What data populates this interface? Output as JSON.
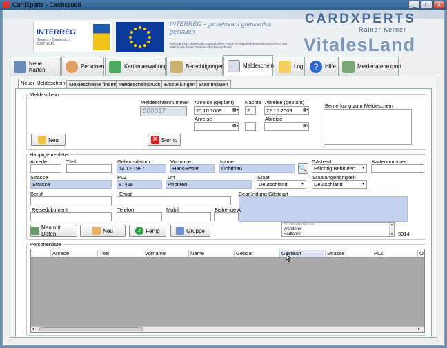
{
  "window": {
    "title": "CardXperts - CardIssueII",
    "min": "_",
    "max": "□",
    "close": "X"
  },
  "banner": {
    "interreg": "INTERREG",
    "interreg_sub": "Bayern - Österreich 2007-2013",
    "slogan": "INTERREG - gemeinsam grenzenlos gestalten",
    "funding": "Gefördert aus Mitteln des Europäischen Fonds für regionale Entwicklung (EFRE), aus Mitteln des Tiroler Tourismusförderungsfonds",
    "logo": "CARDXPERTS",
    "logo_sub": "Rainer Kerner",
    "vitales": "VitalesLand"
  },
  "tabs": [
    {
      "label": "Neue Karten"
    },
    {
      "label": "Personen"
    },
    {
      "label": "Kartenverwaltung"
    },
    {
      "label": "Berechtigungen"
    },
    {
      "label": "Meldeschein"
    },
    {
      "label": "Log"
    },
    {
      "label": "Hilfe"
    },
    {
      "label": "Meldedatenexport"
    }
  ],
  "subtabs": [
    "Neuer Meldeschein",
    "Meldescheine finden",
    "Meldescheindruck",
    "Einstellungen",
    "Stammdaten"
  ],
  "meldeschein": {
    "legend": "Meldeschein",
    "nr_label": "Meldescheinnummer",
    "nr": "500017",
    "an_plan_label": "Anreise (geplant)",
    "an_plan": "20.10.2009",
    "naechte_label": "Nächte",
    "naechte": "2",
    "ab_plan_label": "Abreise (geplant)",
    "ab_plan": "22.10.2009",
    "anreise_label": "Anreise",
    "abreise_label": "Abreise",
    "bemerkung_label": "Bemerkung zum Meldeschein",
    "neu": "Neu",
    "storno": "Storno"
  },
  "haupt": {
    "legend": "Hauptgemeldeter",
    "anrede_label": "Anrede",
    "titel_label": "Titel",
    "geb_label": "Geburtsdatum",
    "geb": "14.12.1987",
    "vorname_label": "Vorname",
    "vorname": "Hans-Peter",
    "name_label": "Name",
    "name": "Lichtblau",
    "gaesteart_label": "Gästeart",
    "gaesteart": "Pflichtig Behindert",
    "kartennr_label": "Kartennummer",
    "strasse_label": "Strasse",
    "strasse": "Strasse",
    "plz_label": "PLZ",
    "plz": "87459",
    "ort_label": "Ort",
    "ort": "Pfronten",
    "staat_label": "Staat",
    "staat": "Deutschland",
    "staatsang_label": "Staatangehörigkeit",
    "staatsang": "Deutschland",
    "beruf_label": "Beruf",
    "email_label": "Email",
    "begr_label": "Begründung Gästeart",
    "reise_label": "Reisedokument",
    "tel_label": "Telefon",
    "mobil_label": "Mobil",
    "bisherige_label": "Bisherige A",
    "list": [
      "Sommerurlauber",
      "Wanderer",
      "Radfahrer"
    ],
    "count": "3914"
  },
  "buttons": {
    "neu_mit_daten": "Neu mit Daten",
    "neu": "Neu",
    "fertig": "Fertig",
    "gruppe": "Gruppe"
  },
  "personen": {
    "legend": "Personenliste",
    "columns": [
      "Anrede",
      "Titel",
      "Vorname",
      "Name",
      "Gebdat",
      "Gästeart",
      "Strasse",
      "PLZ",
      "Ort"
    ]
  }
}
